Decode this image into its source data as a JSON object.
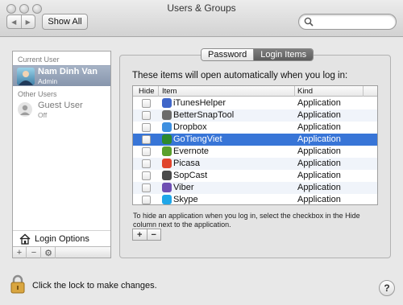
{
  "window": {
    "title": "Users & Groups"
  },
  "toolbar": {
    "show_all_label": "Show All",
    "back_glyph": "◀",
    "forward_glyph": "▶",
    "search_placeholder": ""
  },
  "sidebar": {
    "current_user_header": "Current User",
    "other_users_header": "Other Users",
    "current_user": {
      "name": "Nam Dinh Van",
      "role": "Admin"
    },
    "guest_user": {
      "name": "Guest User",
      "status": "Off"
    },
    "login_options_label": "Login Options",
    "add_glyph": "+",
    "remove_glyph": "−",
    "gear_glyph": "⚙"
  },
  "tabs": [
    {
      "label": "Password",
      "active": false
    },
    {
      "label": "Login Items",
      "active": true
    }
  ],
  "login_items": {
    "heading": "These items will open automatically when you log in:",
    "columns": {
      "hide": "Hide",
      "item": "Item",
      "kind": "Kind"
    },
    "rows": [
      {
        "name": "iTunesHelper",
        "kind": "Application",
        "icon": "itunes-icon",
        "color": "#3f66c9"
      },
      {
        "name": "BetterSnapTool",
        "kind": "Application",
        "icon": "bettersnaptool-icon",
        "color": "#6b6b6b"
      },
      {
        "name": "Dropbox",
        "kind": "Application",
        "icon": "dropbox-icon",
        "color": "#3d8fe0"
      },
      {
        "name": "GoTiengViet",
        "kind": "Application",
        "icon": "gotiengviet-icon",
        "color": "#2d8a2d"
      },
      {
        "name": "Evernote",
        "kind": "Application",
        "icon": "evernote-icon",
        "color": "#5aa02c"
      },
      {
        "name": "Picasa",
        "kind": "Application",
        "icon": "picasa-icon",
        "color": "#e0452d"
      },
      {
        "name": "SopCast",
        "kind": "Application",
        "icon": "sopcast-icon",
        "color": "#4a4a4a"
      },
      {
        "name": "Viber",
        "kind": "Application",
        "icon": "viber-icon",
        "color": "#6f4fb3"
      },
      {
        "name": "Skype",
        "kind": "Application",
        "icon": "skype-icon",
        "color": "#1fa6e8"
      }
    ],
    "selected_index": 3,
    "hint": "To hide an application when you log in, select the checkbox in the Hide column next to the application.",
    "add_glyph": "+",
    "remove_glyph": "−"
  },
  "footer": {
    "lock_text": "Click the lock to make changes.",
    "help_glyph": "?"
  },
  "colors": {
    "selection": "#3875d7",
    "sidebar_selection": "#8d9ab0"
  }
}
